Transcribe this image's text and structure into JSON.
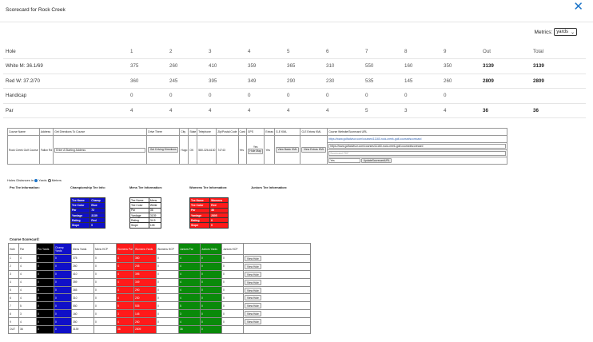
{
  "modal": {
    "title": "Scorecard for Rock Creek",
    "close_glyph": "✕"
  },
  "metrics": {
    "label": "Metrics:",
    "selected": "yards",
    "caret": "⌄"
  },
  "scorecard": {
    "headers": [
      "Hole",
      "1",
      "2",
      "3",
      "4",
      "5",
      "6",
      "7",
      "8",
      "9",
      "Out",
      "Total"
    ],
    "rows": [
      [
        "White M: 36.1/69",
        "375",
        "260",
        "410",
        "359",
        "365",
        "310",
        "550",
        "160",
        "350",
        "3139",
        "3139"
      ],
      [
        "Red W: 37.2/70",
        "360",
        "245",
        "395",
        "349",
        "290",
        "230",
        "535",
        "145",
        "260",
        "2809",
        "2809"
      ],
      [
        "Handicap",
        "0",
        "0",
        "0",
        "0",
        "0",
        "0",
        "0",
        "0",
        "0",
        "",
        ""
      ],
      [
        "Par",
        "4",
        "4",
        "4",
        "4",
        "4",
        "4",
        "5",
        "3",
        "4",
        "36",
        "36"
      ]
    ]
  },
  "course_info": {
    "headers": [
      "Course Name",
      "Address",
      "Get Directions To Course",
      "Drive There",
      "City",
      "State",
      "Telephone",
      "Zip/Postal Code",
      "Card",
      "GPS",
      "Extras",
      "G-E KML",
      "G-E Extras KML",
      "Course Website/Scorecard URL"
    ],
    "name": "Rock Creek Golf Course",
    "address": "Fallon Rd",
    "directions_placeholder": "Enter A Starting Address",
    "drive_button": "Get Driving Directions",
    "city": "Hugo",
    "state": "OK",
    "telephone": "580-326-6130",
    "zip": "74743",
    "card": "Yes",
    "gps_yes": "Yes",
    "gps_button": "Hole Map",
    "extras": "Yes",
    "kml_button": "View Basic KML",
    "extras_kml_button": "View Extras KML",
    "website_link": "https://www.golfadvisor.com/courses/11160-rock-creek-golf-course#scorecard",
    "website_input": "https://www.golfadvisor.com/courses/11160-rock-creek-golf-course#scorecard",
    "pdf_placeholder": "Scorecard PDF",
    "yes_input": "Yes",
    "update_button": "UpdateScorecardURL"
  },
  "hole_distances": {
    "label": "Holes Distances in",
    "yards": "Yards",
    "meters": "Meters"
  },
  "tee_headings": {
    "pro": "Pro Tee Information:",
    "champ": "Championship Tee Info:",
    "mens": "Mens Tee Information:",
    "womens": "Womens Tee Information:",
    "juniors": "Juniors Tee Information:"
  },
  "tee_tables": {
    "champ": [
      [
        "Tee Name",
        "Champ"
      ],
      [
        "Tee Color",
        "Blue"
      ],
      [
        "Par",
        "72"
      ],
      [
        "Yardage",
        "3139"
      ],
      [
        "Rating",
        "Red"
      ],
      [
        "Slope",
        "0"
      ]
    ],
    "mens": [
      [
        "Tee Name",
        "Mens"
      ],
      [
        "Tee Color",
        "White"
      ],
      [
        "Par",
        "36"
      ],
      [
        "Yardage",
        "3139"
      ],
      [
        "Rating",
        "34.5"
      ],
      [
        "Slope",
        "105"
      ]
    ],
    "womens": [
      [
        "Tee Name",
        "Womens"
      ],
      [
        "Tee Color",
        "Red"
      ],
      [
        "Par",
        "36"
      ],
      [
        "Yardage",
        "2805"
      ],
      [
        "Rating",
        "0"
      ],
      [
        "Slope",
        "0"
      ]
    ]
  },
  "course_scorecard": {
    "title": "Course Scorecard:",
    "headers": [
      "Hole",
      "Par",
      "Pro Yards",
      "Champ Yards",
      "Mens Yards",
      "Mens HCP",
      "Womens Par",
      "Womens Yards",
      "Womens HCP",
      "Juniors Par",
      "Juniors Yards",
      "Juniors HCP",
      ""
    ],
    "rows": [
      [
        "1",
        "4",
        "0",
        "0",
        "375",
        "0",
        "4",
        "360",
        "0",
        "4",
        "0",
        "0",
        "View Hole"
      ],
      [
        "2",
        "4",
        "0",
        "0",
        "260",
        "0",
        "4",
        "245",
        "0",
        "4",
        "0",
        "0",
        "View Hole"
      ],
      [
        "3",
        "4",
        "0",
        "0",
        "410",
        "0",
        "4",
        "395",
        "0",
        "4",
        "0",
        "0",
        "View Hole"
      ],
      [
        "4",
        "4",
        "0",
        "0",
        "359",
        "0",
        "4",
        "349",
        "0",
        "4",
        "0",
        "0",
        "View Hole"
      ],
      [
        "5",
        "4",
        "0",
        "0",
        "365",
        "0",
        "4",
        "290",
        "0",
        "4",
        "0",
        "0",
        "View Hole"
      ],
      [
        "6",
        "4",
        "0",
        "0",
        "310",
        "0",
        "4",
        "230",
        "0",
        "4",
        "0",
        "0",
        "View Hole"
      ],
      [
        "7",
        "5",
        "0",
        "0",
        "550",
        "0",
        "5",
        "535",
        "0",
        "5",
        "0",
        "0",
        "View Hole"
      ],
      [
        "8",
        "3",
        "0",
        "0",
        "160",
        "0",
        "3",
        "145",
        "0",
        "3",
        "0",
        "0",
        "View Hole"
      ],
      [
        "9",
        "4",
        "0",
        "0",
        "350",
        "0",
        "4",
        "260",
        "0",
        "4",
        "0",
        "0",
        "View Hole"
      ],
      [
        "OUT",
        "36",
        "0",
        "0",
        "3139",
        "",
        "36",
        "2809",
        "",
        "36",
        "0",
        "",
        ""
      ]
    ]
  }
}
